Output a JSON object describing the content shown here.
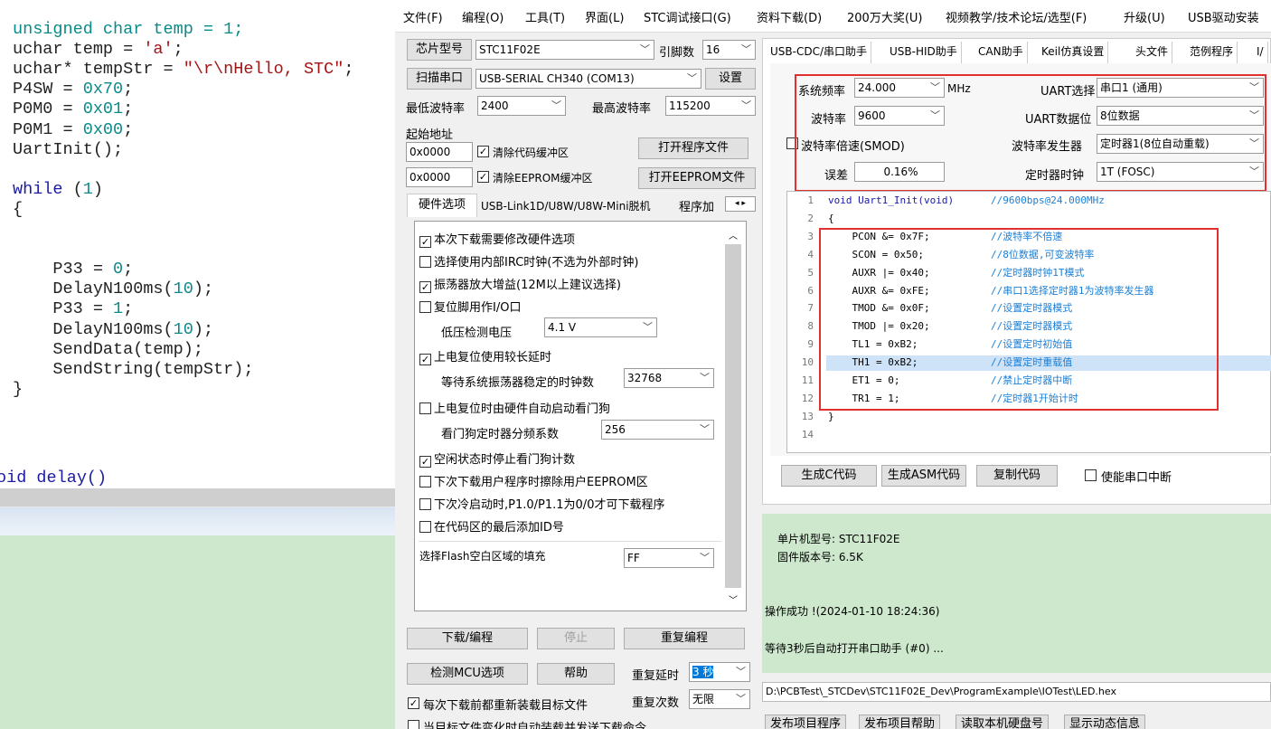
{
  "editor": {
    "lines": [
      {
        "t": "unsigned char temp = 1;",
        "parts": [
          [
            "unsigned char temp = 1;",
            "num"
          ]
        ]
      },
      {
        "parts": [
          [
            "uchar temp = ",
            "plain"
          ],
          [
            "'a'",
            "str"
          ],
          [
            ";",
            "plain"
          ]
        ]
      },
      {
        "parts": [
          [
            "uchar* tempStr = ",
            "plain"
          ],
          [
            "\"\\r\\nHello, STC\"",
            "str"
          ],
          [
            ";",
            "plain"
          ]
        ]
      },
      {
        "parts": [
          [
            "P4SW = ",
            "plain"
          ],
          [
            "0x70",
            "num"
          ],
          [
            ";",
            "plain"
          ]
        ]
      },
      {
        "parts": [
          [
            "P0M0 = ",
            "plain"
          ],
          [
            "0x01",
            "num"
          ],
          [
            ";",
            "plain"
          ]
        ]
      },
      {
        "parts": [
          [
            "P0M1 = ",
            "plain"
          ],
          [
            "0x00",
            "num"
          ],
          [
            ";",
            "plain"
          ]
        ]
      },
      {
        "parts": [
          [
            "UartInit();",
            "plain"
          ]
        ]
      },
      {
        "parts": [
          [
            "",
            "plain"
          ]
        ]
      },
      {
        "parts": [
          [
            "while",
            "kw"
          ],
          [
            " (",
            "plain"
          ],
          [
            "1",
            "num"
          ],
          [
            ")",
            "plain"
          ]
        ]
      },
      {
        "parts": [
          [
            "{",
            "plain"
          ]
        ]
      },
      {
        "parts": [
          [
            "",
            "plain"
          ]
        ]
      },
      {
        "parts": [
          [
            "",
            "plain"
          ]
        ]
      },
      {
        "parts": [
          [
            "    P33 = ",
            "plain"
          ],
          [
            "0",
            "num"
          ],
          [
            ";",
            "plain"
          ]
        ]
      },
      {
        "parts": [
          [
            "    DelayN100ms(",
            "plain"
          ],
          [
            "10",
            "num"
          ],
          [
            ");",
            "plain"
          ]
        ]
      },
      {
        "parts": [
          [
            "    P33 = ",
            "plain"
          ],
          [
            "1",
            "num"
          ],
          [
            ";",
            "plain"
          ]
        ]
      },
      {
        "parts": [
          [
            "    DelayN100ms(",
            "plain"
          ],
          [
            "10",
            "num"
          ],
          [
            ");",
            "plain"
          ]
        ]
      },
      {
        "parts": [
          [
            "    SendData(temp);",
            "plain"
          ]
        ]
      },
      {
        "parts": [
          [
            "    SendString(tempStr);",
            "plain"
          ]
        ]
      },
      {
        "parts": [
          [
            "}",
            "plain"
          ]
        ]
      }
    ],
    "last_line": "oid delay()"
  },
  "menu": [
    "文件(F)",
    "编程(O)",
    "工具(T)",
    "界面(L)",
    "STC调试接口(G)",
    "资料下载(D)",
    "200万大奖(U)",
    "视频教学/技术论坛/选型(F)",
    "升级(U)",
    "USB驱动安装"
  ],
  "left": {
    "chip_label": "芯片型号",
    "chip_value": "STC11F02E",
    "pins_label": "引脚数",
    "pins_value": "16",
    "scan_btn": "扫描串口",
    "port_value": "USB-SERIAL CH340 (COM13)",
    "settings_btn": "设置",
    "min_baud_label": "最低波特率",
    "min_baud": "2400",
    "max_baud_label": "最高波特率",
    "max_baud": "115200",
    "start_addr_label": "起始地址",
    "addr1": "0x0000",
    "clear_code": "清除代码缓冲区",
    "open_prog": "打开程序文件",
    "addr2": "0x0000",
    "clear_eeprom": "清除EEPROM缓冲区",
    "open_eeprom": "打开EEPROM文件",
    "tabs": [
      "硬件选项",
      "USB-Link1D/U8W/U8W-Mini脱机",
      "程序加"
    ],
    "options": [
      {
        "label": "本次下载需要修改硬件选项",
        "checked": true
      },
      {
        "label": "选择使用内部IRC时钟(不选为外部时钟)",
        "checked": false
      },
      {
        "label": "振荡器放大增益(12M以上建议选择)",
        "checked": true
      },
      {
        "label": "复位脚用作I/O口",
        "checked": false
      }
    ],
    "lv_label": "低压检测电压",
    "lv_value": "4.1 V",
    "opt_power_delay": "上电复位使用较长延时",
    "osc_wait_label": "等待系统振荡器稳定的时钟数",
    "osc_wait": "32768",
    "opt_wdt": "上电复位时由硬件自动启动看门狗",
    "wdt_div_label": "看门狗定时器分频系数",
    "wdt_div": "256",
    "opt_idle": "空闲状态时停止看门狗计数",
    "opt_erase": "下次下载用户程序时擦除用户EEPROM区",
    "opt_cold": "下次冷启动时,P1.0/P1.1为0/0才可下载程序",
    "opt_id": "在代码区的最后添加ID号",
    "flash_fill_label": "选择Flash空白区域的填充",
    "flash_fill": "FF",
    "download_btn": "下载/编程",
    "stop_btn": "停止",
    "reprog_btn": "重复编程",
    "detect_btn": "检测MCU选项",
    "help_btn": "帮助",
    "repeat_delay_label": "重复延时",
    "repeat_delay": "3 秒",
    "reload_label": "每次下载前都重新装载目标文件",
    "repeat_count_label": "重复次数",
    "repeat_count": "无限",
    "auto_label": "当目标文件变化时自动装载并发送下载命令"
  },
  "right": {
    "tabs": [
      "USB-CDC/串口助手",
      "USB-HID助手",
      "CAN助手",
      "Keil仿真设置",
      "头文件",
      "范例程序",
      "I/"
    ],
    "sysfreq_label": "系统频率",
    "sysfreq": "24.000",
    "mhz": "MHz",
    "uart_sel_label": "UART选择",
    "uart_sel": "串口1 (通用)",
    "baud_label": "波特率",
    "baud": "9600",
    "uart_bits_label": "UART数据位",
    "uart_bits": "8位数据",
    "smod_label": "波特率倍速(SMOD)",
    "baudgen_label": "波特率发生器",
    "baudgen": "定时器1(8位自动重载)",
    "err_label": "误差",
    "err": "0.16%",
    "timer_clk_label": "定时器时钟",
    "timer_clk": "1T  (FOSC)",
    "code": [
      {
        "n": "1",
        "c": "void Uart1_Init(void)",
        "m": "//9600bps@24.000MHz"
      },
      {
        "n": "2",
        "c": "{",
        "m": ""
      },
      {
        "n": "3",
        "c": "    PCON &= 0x7F;",
        "m": "//波特率不倍速"
      },
      {
        "n": "4",
        "c": "    SCON = 0x50;",
        "m": "//8位数据,可变波特率"
      },
      {
        "n": "5",
        "c": "    AUXR |= 0x40;",
        "m": "//定时器时钟1T模式"
      },
      {
        "n": "6",
        "c": "    AUXR &= 0xFE;",
        "m": "//串口1选择定时器1为波特率发生器"
      },
      {
        "n": "7",
        "c": "    TMOD &= 0x0F;",
        "m": "//设置定时器模式"
      },
      {
        "n": "8",
        "c": "    TMOD |= 0x20;",
        "m": "//设置定时器模式"
      },
      {
        "n": "9",
        "c": "    TL1 = 0xB2;",
        "m": "//设置定时初始值"
      },
      {
        "n": "10",
        "c": "    TH1 = 0xB2;",
        "m": "//设置定时重载值"
      },
      {
        "n": "11",
        "c": "    ET1 = 0;",
        "m": "//禁止定时器中断"
      },
      {
        "n": "12",
        "c": "    TR1 = 1;",
        "m": "//定时器1开始计时"
      },
      {
        "n": "13",
        "c": "}",
        "m": ""
      },
      {
        "n": "14",
        "c": "",
        "m": ""
      }
    ],
    "gen_c_btn": "生成C代码",
    "gen_asm_btn": "生成ASM代码",
    "copy_btn": "复制代码",
    "enable_int": "使能串口中断",
    "mcu_model": "单片机型号: STC11F02E",
    "fw_ver": "固件版本号: 6.5K",
    "op_ok": "操作成功 !(2024-01-10 18:24:36)",
    "wait_msg": "等待3秒后自动打开串口助手 (#0) ...",
    "file_path": "D:\\PCBTest\\_STCDev\\STC11F02E_Dev\\ProgramExample\\IOTest\\LED.hex",
    "bottom_btns": [
      "发布项目程序",
      "发布项目帮助",
      "读取本机硬盘号",
      "显示动态信息"
    ]
  }
}
